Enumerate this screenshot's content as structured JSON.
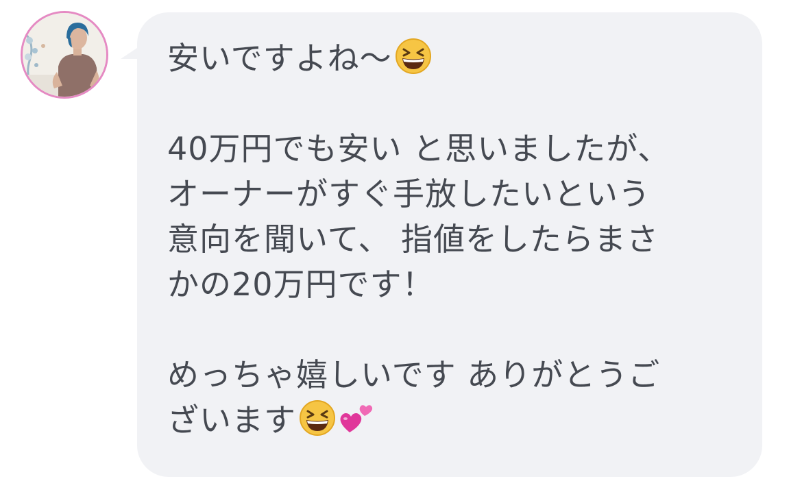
{
  "message": {
    "paragraph_1": "安いですよね〜",
    "paragraph_2_lines": [
      "40万円でも安い と思いましたが、",
      "オーナーがすぐ手放したいという",
      "意向を聞いて、 指値をしたらまさ",
      "かの20万円です！"
    ],
    "paragraph_3_lines": [
      "めっちゃ嬉しいです ありがとうご",
      "ざいます"
    ]
  },
  "emojis": {
    "first": "grinning-squinting-face-icon",
    "end_1": "grinning-squinting-face-icon",
    "end_2": "two-hearts-icon"
  },
  "colors": {
    "bubble": "#f1f2f5",
    "text": "#454951",
    "avatar_ring": "#e58ac3"
  }
}
